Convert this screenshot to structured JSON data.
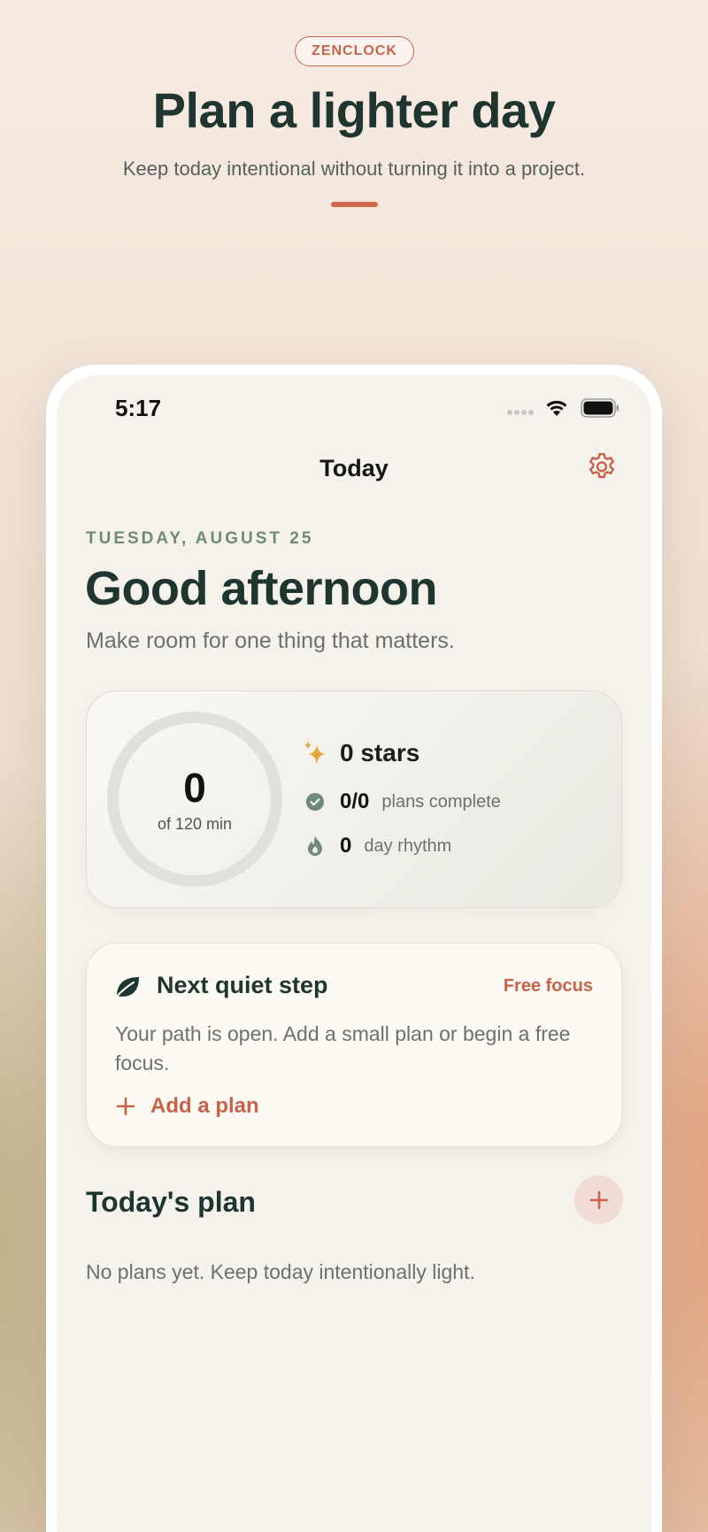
{
  "marketing": {
    "badge": "ZENCLOCK",
    "title": "Plan a lighter day",
    "subtitle": "Keep today intentional without turning it into a project."
  },
  "status_bar": {
    "time": "5:17",
    "icons": [
      "signal-icon",
      "wifi-icon",
      "battery-icon"
    ]
  },
  "nav": {
    "title": "Today",
    "settings_icon": "gear-icon"
  },
  "header": {
    "date": "TUESDAY, AUGUST 25",
    "greeting": "Good afternoon",
    "tagline": "Make room for one thing that matters."
  },
  "stats": {
    "focus_minutes": "0",
    "focus_goal_label": "of 120 min",
    "focus_progress": 0,
    "stars": "0 stars",
    "plans_complete_value": "0/0",
    "plans_complete_label": "plans complete",
    "rhythm_value": "0",
    "rhythm_label": "day rhythm"
  },
  "next_step": {
    "title": "Next quiet step",
    "action": "Free focus",
    "body": "Your path is open. Add a small plan or begin a free focus.",
    "add_label": "Add a plan"
  },
  "plans": {
    "heading": "Today's plan",
    "empty": "No plans yet. Keep today intentionally light."
  },
  "colors": {
    "accent": "#c9624a",
    "ink": "#1f3530",
    "sage": "#6f8a7a",
    "gold": "#e6a83c"
  }
}
